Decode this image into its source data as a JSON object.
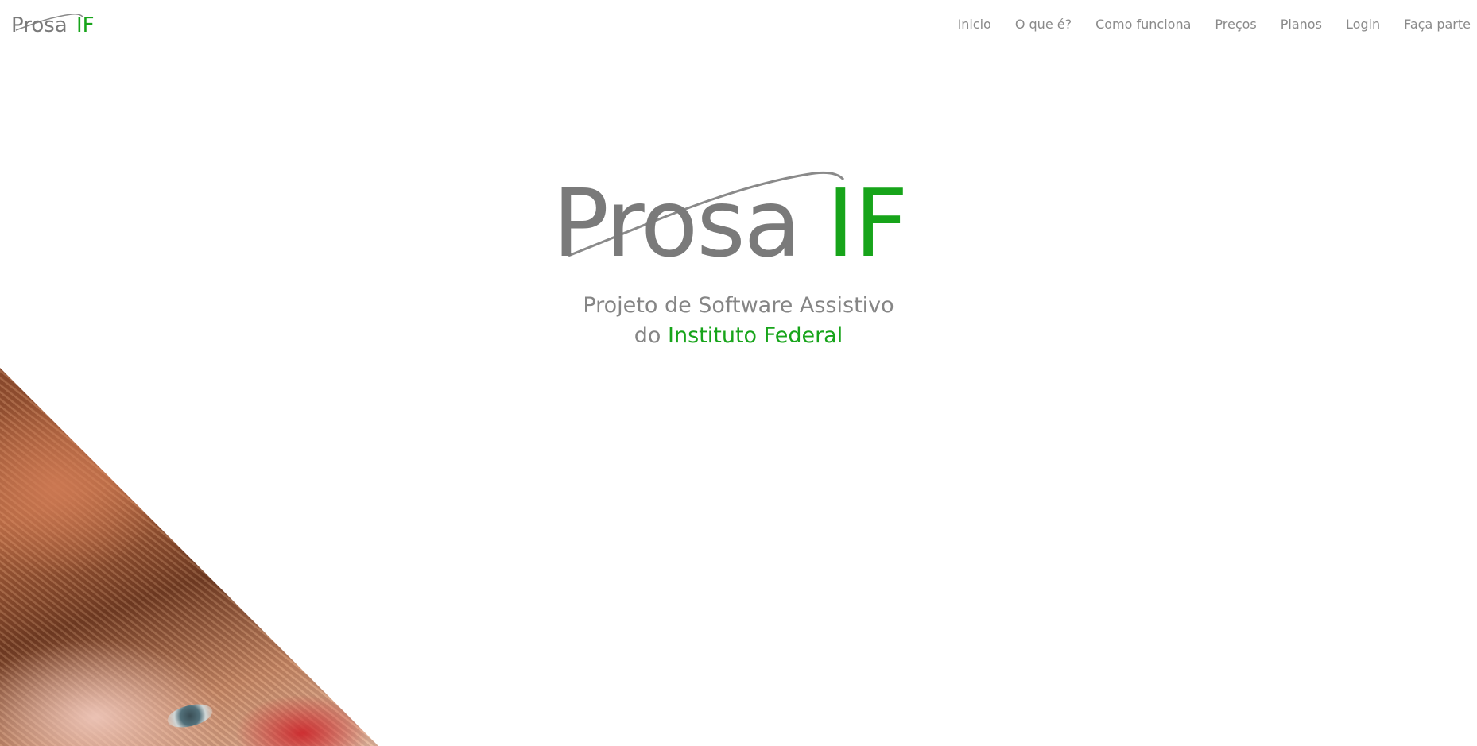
{
  "header": {
    "brand": {
      "part1": "Prosa",
      "part2": "IF"
    },
    "nav": [
      {
        "label": "Inicio"
      },
      {
        "label": "O que é?"
      },
      {
        "label": "Como funciona"
      },
      {
        "label": "Preços"
      },
      {
        "label": "Planos"
      },
      {
        "label": "Login"
      },
      {
        "label": "Faça parte"
      }
    ]
  },
  "hero": {
    "logo": {
      "part1": "Prosa",
      "part2": "IF"
    },
    "tagline": {
      "line1": "Projeto de Software Assistivo",
      "line2_prefix": "do ",
      "line2_highlight": "Instituto Federal"
    }
  },
  "colors": {
    "brand_gray": "#7a7a7a",
    "brand_green": "#17a41a",
    "nav_text": "#8a8a8a"
  }
}
